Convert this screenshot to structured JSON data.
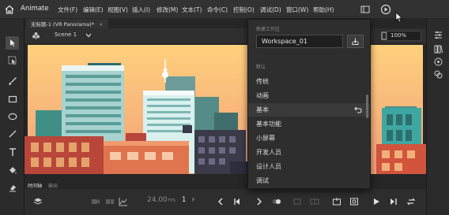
{
  "menubar": {
    "app_name": "Animate",
    "menus": [
      "文件(F)",
      "编辑(E)",
      "视图(V)",
      "插入(I)",
      "修改(M)",
      "文本(T)",
      "命令(C)",
      "控制(O)",
      "调试(D)",
      "窗口(W)",
      "帮助(H)"
    ]
  },
  "document": {
    "tab_title": "无标题-1 (VR Panorama)*",
    "tab_close": "×",
    "scene_label": "Scene 1",
    "zoom": "100%"
  },
  "workspace_menu": {
    "new_workspace_label": "新建工作区",
    "workspace_name": "Workspace_01",
    "default_label": "默认",
    "items": [
      "传统",
      "动画",
      "基本",
      "基本功能",
      "小屏幕",
      "开发人员",
      "设计人员",
      "调试"
    ],
    "active_item": "基本"
  },
  "timeline": {
    "tabs": [
      "时间轴",
      "输出"
    ],
    "fps_value": "24.00",
    "fps_unit": "FPS",
    "frame_value": "1",
    "frame_unit": "F"
  },
  "colors": {
    "sky_top": "#ffd07d",
    "sky_bottom": "#f2a07a",
    "accent": "#2d8cf0",
    "panel": "#2e2e2e"
  }
}
